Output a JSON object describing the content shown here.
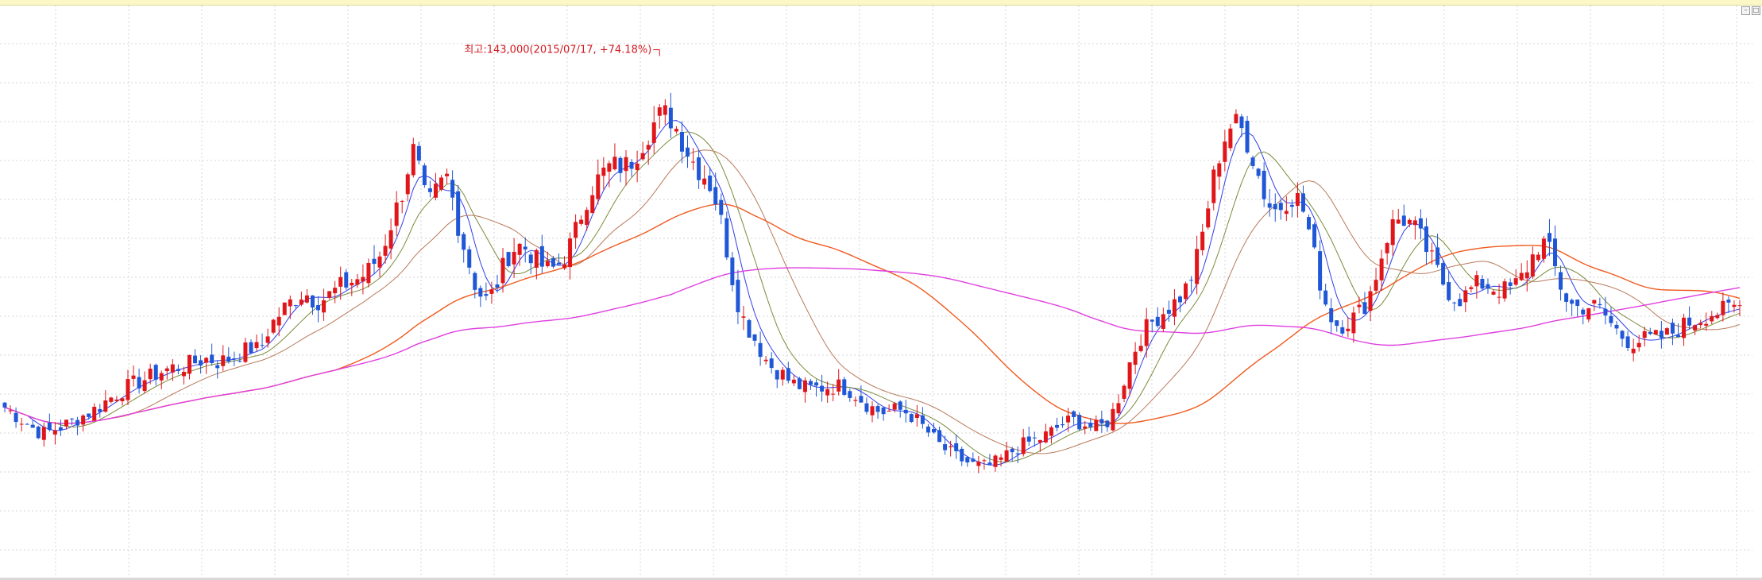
{
  "window": {
    "minimize_glyph": "–",
    "maximize_glyph": "□"
  },
  "chart_data": {
    "type": "candlestick",
    "title": "",
    "xlabel": "",
    "ylabel": "",
    "grid": true,
    "legend": "none",
    "ylim": [
      55000,
      150000
    ],
    "annotation": {
      "text": "최고:143,000(2015/07/17, +74.18%)",
      "value": 143000,
      "date": "2015/07/17",
      "change": "+74.18%"
    },
    "colors": {
      "up": "#e0161b",
      "down": "#1f57d6",
      "ma5": "#2f3fe8",
      "ma10": "#7a8b3a",
      "ma20": "#b87a5a",
      "ma60": "#f05a1f",
      "ma120": "#e040e0",
      "grid": "#d4d4d4"
    },
    "series": [
      {
        "name": "ma5",
        "period": 5,
        "color": "#2f3fe8"
      },
      {
        "name": "ma10",
        "period": 10,
        "color": "#7a8b3a"
      },
      {
        "name": "ma20",
        "period": 20,
        "color": "#b87a5a"
      },
      {
        "name": "ma60",
        "period": 60,
        "color": "#f05a1f"
      },
      {
        "name": "ma120",
        "period": 120,
        "color": "#e040e0"
      }
    ],
    "close": [
      83000,
      82300,
      81600,
      80900,
      80200,
      79500,
      78900,
      78600,
      78900,
      79300,
      79700,
      80100,
      80600,
      81100,
      81600,
      82100,
      82600,
      83200,
      84000,
      84700,
      85300,
      85900,
      86500,
      87000,
      87400,
      87800,
      88200,
      88700,
      89100,
      89500,
      89800,
      89900,
      90100,
      90400,
      90700,
      91000,
      91300,
      91100,
      90800,
      91000,
      91300,
      91700,
      92200,
      92700,
      93100,
      92900,
      93700,
      96000,
      97600,
      98800,
      100000,
      100900,
      101700,
      102400,
      102300,
      101500,
      101200,
      101600,
      102200,
      102900,
      103600,
      104100,
      104500,
      104900,
      105500,
      106400,
      107700,
      109000,
      111500,
      114300,
      117000,
      119800,
      123800,
      126800,
      123600,
      119000,
      118000,
      119700,
      121200,
      122300,
      118600,
      114200,
      110600,
      107400,
      104100,
      102300,
      101400,
      102300,
      104300,
      106800,
      109000,
      110100,
      110600,
      110200,
      109200,
      108000,
      107200,
      106600,
      106700,
      107500,
      108800,
      110700,
      113100,
      116000,
      118700,
      120700,
      121900,
      123100,
      124000,
      124200,
      124200,
      124300,
      125200,
      126700,
      128300,
      130000,
      131500,
      132700,
      133000,
      132300,
      130600,
      128700,
      126800,
      125000,
      123700,
      122700,
      121100,
      118500,
      114700,
      110000,
      105100,
      101000,
      98100,
      96300,
      94700,
      92900,
      91200,
      90000,
      89300,
      88600,
      87700,
      87000,
      86600,
      86300,
      86200,
      86300,
      86400,
      86500,
      86600,
      86600,
      86400,
      85900,
      85200,
      84400,
      83600,
      82900,
      82400,
      82200,
      82300,
      82500,
      82500,
      82200,
      81600,
      80700,
      79700,
      78700,
      77600,
      76600,
      75800,
      75100,
      74500,
      74000,
      73600,
      73200,
      73000,
      72900,
      73100,
      73500,
      74100,
      74800,
      75500,
      76100,
      76600,
      77000,
      77300,
      77700,
      78200,
      78800,
      79500,
      80100,
      80500,
      80700,
      80500,
      80100,
      79700,
      79500,
      79800,
      80600,
      82200,
      84700,
      87600,
      90600,
      93100,
      95100,
      96500,
      97600,
      98500,
      99300,
      100100,
      100900,
      101900,
      103300,
      105400,
      108500,
      112600,
      117400,
      122200,
      126100,
      129100,
      131000,
      131300,
      130400,
      128400,
      125700,
      122600,
      119600,
      117500,
      116800,
      117400,
      118500,
      119100,
      118600,
      116600,
      113200,
      108800,
      104400,
      100900,
      98500,
      97300,
      97200,
      97700,
      98400,
      99300,
      100600,
      102700,
      105600,
      109000,
      112100,
      114200,
      115100,
      115100,
      114500,
      113400,
      111800,
      110000,
      108100,
      106200,
      104300,
      102800,
      101800,
      101600,
      102200,
      103200,
      103900,
      104100,
      103800,
      103400,
      103100,
      103000,
      103300,
      104000,
      105200,
      106900,
      108800,
      110500,
      111000,
      109500,
      106700,
      103700,
      101600,
      100500,
      100100,
      100200,
      100300,
      100200,
      99600,
      98600,
      97300,
      96100,
      95100,
      94500,
      94200,
      94400,
      94600,
      94700,
      94800,
      95000,
      95300,
      95800,
      96400,
      97000,
      97500,
      97900,
      98300,
      98800,
      99100,
      99300,
      99500,
      99800,
      100100,
      100300
    ],
    "peak_index": 117
  }
}
